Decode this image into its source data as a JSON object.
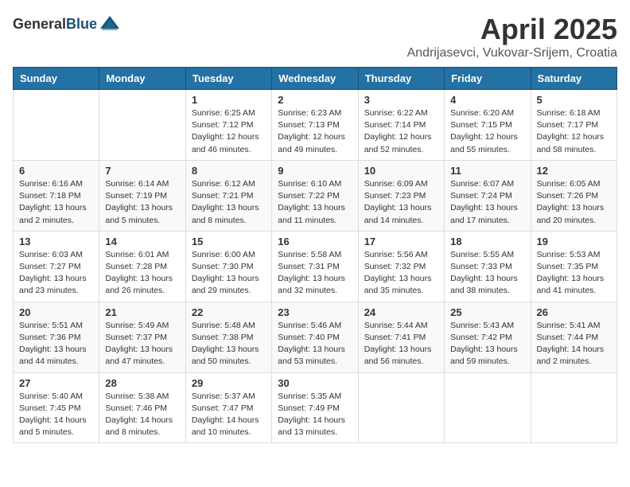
{
  "header": {
    "logo_general": "General",
    "logo_blue": "Blue",
    "month": "April 2025",
    "location": "Andrijasevci, Vukovar-Srijem, Croatia"
  },
  "weekdays": [
    "Sunday",
    "Monday",
    "Tuesday",
    "Wednesday",
    "Thursday",
    "Friday",
    "Saturday"
  ],
  "weeks": [
    [
      {
        "day": "",
        "info": ""
      },
      {
        "day": "",
        "info": ""
      },
      {
        "day": "1",
        "info": "Sunrise: 6:25 AM\nSunset: 7:12 PM\nDaylight: 12 hours\nand 46 minutes."
      },
      {
        "day": "2",
        "info": "Sunrise: 6:23 AM\nSunset: 7:13 PM\nDaylight: 12 hours\nand 49 minutes."
      },
      {
        "day": "3",
        "info": "Sunrise: 6:22 AM\nSunset: 7:14 PM\nDaylight: 12 hours\nand 52 minutes."
      },
      {
        "day": "4",
        "info": "Sunrise: 6:20 AM\nSunset: 7:15 PM\nDaylight: 12 hours\nand 55 minutes."
      },
      {
        "day": "5",
        "info": "Sunrise: 6:18 AM\nSunset: 7:17 PM\nDaylight: 12 hours\nand 58 minutes."
      }
    ],
    [
      {
        "day": "6",
        "info": "Sunrise: 6:16 AM\nSunset: 7:18 PM\nDaylight: 13 hours\nand 2 minutes."
      },
      {
        "day": "7",
        "info": "Sunrise: 6:14 AM\nSunset: 7:19 PM\nDaylight: 13 hours\nand 5 minutes."
      },
      {
        "day": "8",
        "info": "Sunrise: 6:12 AM\nSunset: 7:21 PM\nDaylight: 13 hours\nand 8 minutes."
      },
      {
        "day": "9",
        "info": "Sunrise: 6:10 AM\nSunset: 7:22 PM\nDaylight: 13 hours\nand 11 minutes."
      },
      {
        "day": "10",
        "info": "Sunrise: 6:09 AM\nSunset: 7:23 PM\nDaylight: 13 hours\nand 14 minutes."
      },
      {
        "day": "11",
        "info": "Sunrise: 6:07 AM\nSunset: 7:24 PM\nDaylight: 13 hours\nand 17 minutes."
      },
      {
        "day": "12",
        "info": "Sunrise: 6:05 AM\nSunset: 7:26 PM\nDaylight: 13 hours\nand 20 minutes."
      }
    ],
    [
      {
        "day": "13",
        "info": "Sunrise: 6:03 AM\nSunset: 7:27 PM\nDaylight: 13 hours\nand 23 minutes."
      },
      {
        "day": "14",
        "info": "Sunrise: 6:01 AM\nSunset: 7:28 PM\nDaylight: 13 hours\nand 26 minutes."
      },
      {
        "day": "15",
        "info": "Sunrise: 6:00 AM\nSunset: 7:30 PM\nDaylight: 13 hours\nand 29 minutes."
      },
      {
        "day": "16",
        "info": "Sunrise: 5:58 AM\nSunset: 7:31 PM\nDaylight: 13 hours\nand 32 minutes."
      },
      {
        "day": "17",
        "info": "Sunrise: 5:56 AM\nSunset: 7:32 PM\nDaylight: 13 hours\nand 35 minutes."
      },
      {
        "day": "18",
        "info": "Sunrise: 5:55 AM\nSunset: 7:33 PM\nDaylight: 13 hours\nand 38 minutes."
      },
      {
        "day": "19",
        "info": "Sunrise: 5:53 AM\nSunset: 7:35 PM\nDaylight: 13 hours\nand 41 minutes."
      }
    ],
    [
      {
        "day": "20",
        "info": "Sunrise: 5:51 AM\nSunset: 7:36 PM\nDaylight: 13 hours\nand 44 minutes."
      },
      {
        "day": "21",
        "info": "Sunrise: 5:49 AM\nSunset: 7:37 PM\nDaylight: 13 hours\nand 47 minutes."
      },
      {
        "day": "22",
        "info": "Sunrise: 5:48 AM\nSunset: 7:38 PM\nDaylight: 13 hours\nand 50 minutes."
      },
      {
        "day": "23",
        "info": "Sunrise: 5:46 AM\nSunset: 7:40 PM\nDaylight: 13 hours\nand 53 minutes."
      },
      {
        "day": "24",
        "info": "Sunrise: 5:44 AM\nSunset: 7:41 PM\nDaylight: 13 hours\nand 56 minutes."
      },
      {
        "day": "25",
        "info": "Sunrise: 5:43 AM\nSunset: 7:42 PM\nDaylight: 13 hours\nand 59 minutes."
      },
      {
        "day": "26",
        "info": "Sunrise: 5:41 AM\nSunset: 7:44 PM\nDaylight: 14 hours\nand 2 minutes."
      }
    ],
    [
      {
        "day": "27",
        "info": "Sunrise: 5:40 AM\nSunset: 7:45 PM\nDaylight: 14 hours\nand 5 minutes."
      },
      {
        "day": "28",
        "info": "Sunrise: 5:38 AM\nSunset: 7:46 PM\nDaylight: 14 hours\nand 8 minutes."
      },
      {
        "day": "29",
        "info": "Sunrise: 5:37 AM\nSunset: 7:47 PM\nDaylight: 14 hours\nand 10 minutes."
      },
      {
        "day": "30",
        "info": "Sunrise: 5:35 AM\nSunset: 7:49 PM\nDaylight: 14 hours\nand 13 minutes."
      },
      {
        "day": "",
        "info": ""
      },
      {
        "day": "",
        "info": ""
      },
      {
        "day": "",
        "info": ""
      }
    ]
  ]
}
